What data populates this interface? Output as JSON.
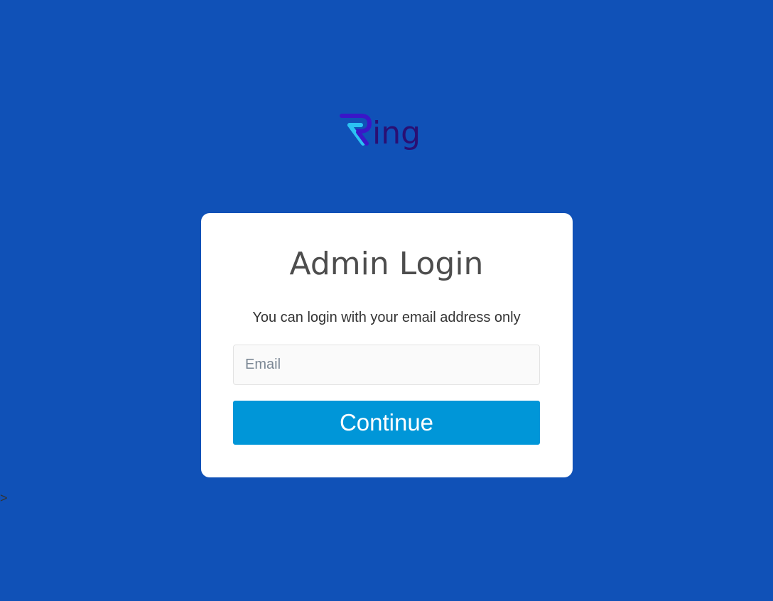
{
  "logo": {
    "wordmark": "ing",
    "colors": {
      "r_light": "#2bc2f3",
      "r_dark": "#3a16c8",
      "text": "#2a0f73"
    }
  },
  "login": {
    "title": "Admin Login",
    "subtitle": "You can login with your email address only",
    "email_placeholder": "Email",
    "email_value": "",
    "continue_label": "Continue"
  },
  "stray_text": ">",
  "colors": {
    "background": "#1051b7",
    "card": "#ffffff",
    "button": "#0096d8",
    "input_bg": "#fafafa"
  }
}
